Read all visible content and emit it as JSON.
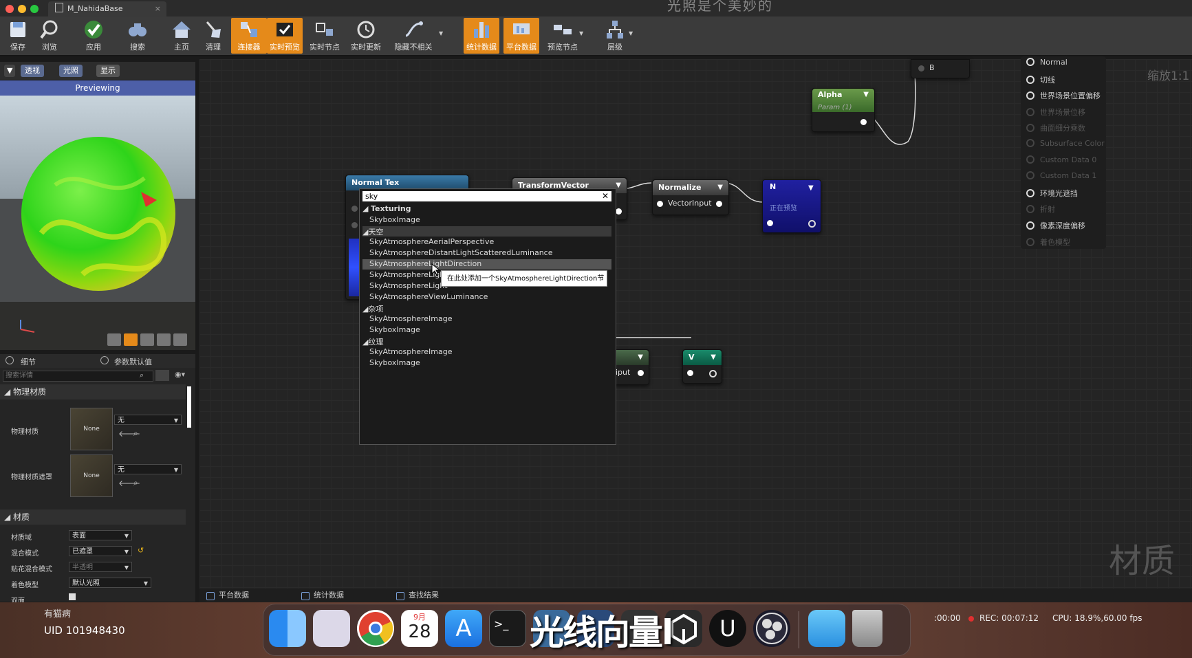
{
  "titlebar": {
    "tab_label": "M_NahidaBase",
    "window_title": "光照是个美妙的"
  },
  "toolbar": {
    "buttons": [
      "保存",
      "浏览",
      "应用",
      "搜索",
      "主页",
      "清理",
      "连接器",
      "实时预览",
      "实时节点",
      "实时更新",
      "隐藏不相关",
      "统计数据",
      "平台数据",
      "预览节点",
      "层级"
    ]
  },
  "viewport": {
    "buttons": [
      "透视",
      "光照",
      "显示"
    ],
    "previewing": "Previewing"
  },
  "details": {
    "tabs": [
      "细节",
      "参数默认值"
    ],
    "search_placeholder": "搜索详情",
    "section_physical": "物理材质",
    "phys_mat_label": "物理材质",
    "phys_mat_thumb": "None",
    "phys_mat_value": "无",
    "phys_mask_label": "物理材质遮罩",
    "phys_mask_thumb": "None",
    "phys_mask_value": "无",
    "section_material": "材质",
    "props": [
      {
        "label": "材质域",
        "value": "表面"
      },
      {
        "label": "混合模式",
        "value": "已遮罩"
      },
      {
        "label": "贴花混合模式",
        "value": "半透明"
      },
      {
        "label": "着色模型",
        "value": "默认光照"
      },
      {
        "label": "双面",
        "value": ""
      }
    ]
  },
  "graph": {
    "zoom": "缩放1:1",
    "watermark": "材质",
    "nodes": {
      "normal_tex": "Normal Tex",
      "transform_vector": "TransformVector",
      "normalize": "Normalize",
      "normalize_pin": "VectorInput",
      "n_title": "N",
      "n_sub": "正在预览",
      "alpha_title": "Alpha",
      "alpha_sub": "Param (1)",
      "b_pin": "B",
      "v_title": "V",
      "hidden_output": "iput"
    },
    "output_pins": [
      {
        "label": "Normal",
        "dim": false
      },
      {
        "label": "切线",
        "dim": false
      },
      {
        "label": "世界场景位置偏移",
        "dim": false
      },
      {
        "label": "世界场景位移",
        "dim": true
      },
      {
        "label": "曲面细分乘数",
        "dim": true
      },
      {
        "label": "Subsurface Color",
        "dim": true
      },
      {
        "label": "Custom Data 0",
        "dim": true
      },
      {
        "label": "Custom Data 1",
        "dim": true
      },
      {
        "label": "环境光遮挡",
        "dim": false
      },
      {
        "label": "折射",
        "dim": true
      },
      {
        "label": "像素深度偏移",
        "dim": false
      },
      {
        "label": "着色模型",
        "dim": true
      }
    ]
  },
  "popup": {
    "search_value": "sky",
    "cat_texturing": "Texturing",
    "item_0": "SkyboxImage",
    "cat_sky": "天空",
    "item_1": "SkyAtmosphereAerialPerspective",
    "item_2": "SkyAtmosphereDistantLightScatteredLuminance",
    "item_3": "SkyAtmosphereLightDirection",
    "item_4": "SkyAtmosphereLight",
    "item_5": "SkyAtmosphereLight",
    "item_6": "SkyAtmosphereViewLuminance",
    "cat_misc": "杂项",
    "item_7": "SkyAtmosphereImage",
    "item_8": "SkyboxImage",
    "cat_texture": "纹理",
    "item_9": "SkyAtmosphereImage",
    "item_10": "SkyboxImage",
    "tooltip": "在此处添加一个SkyAtmosphereLightDirection节点"
  },
  "bottom_tabs": [
    "平台数据",
    "统计数据",
    "查找结果"
  ],
  "overlay": {
    "user": "有猫病",
    "uid": "UID 101948430",
    "subtitle": "光线向量l",
    "time": ":00:00",
    "rec": "REC: 00:07:12",
    "cpu": "CPU: 18.9%,60.00 fps",
    "calendar_month": "9月",
    "calendar_day": "28"
  }
}
